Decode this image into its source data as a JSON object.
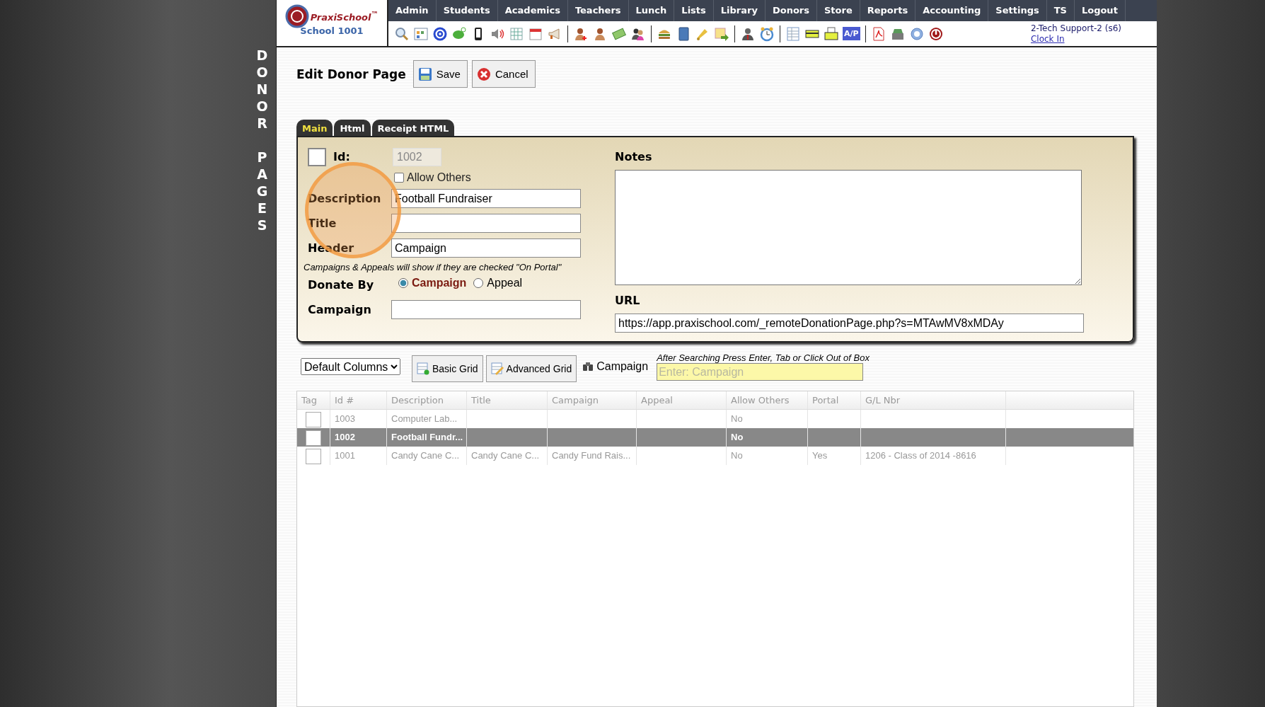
{
  "side_title": "DONOR PAGES",
  "logo": {
    "name": "PraxiSchool$^{™}$",
    "school": "School 1001"
  },
  "menu": [
    "Admin",
    "Students",
    "Academics",
    "Teachers",
    "Lunch",
    "Lists",
    "Library",
    "Donors",
    "Store",
    "Reports",
    "Accounting",
    "Settings",
    "TS",
    "Logout"
  ],
  "toolbar": {
    "ap_label": "A/P"
  },
  "user": {
    "name": "2-Tech Support-2 (s6)",
    "link": "Clock In"
  },
  "page_title": "Edit Donor Page",
  "buttons": [
    {
      "label": "Save",
      "kind": "save"
    },
    {
      "label": "Cancel",
      "kind": "cancel"
    }
  ],
  "tabs": [
    {
      "label": "Main",
      "selected": true
    },
    {
      "label": "Html",
      "selected": false
    },
    {
      "label": "Receipt HTML",
      "selected": false
    }
  ],
  "form": {
    "tagged": false,
    "id_label": "Id:",
    "id_value": "1002",
    "allow_others": {
      "label": "Allow Others",
      "checked": false
    },
    "fields": [
      {
        "label": "Description",
        "value": "Football Fundraiser"
      },
      {
        "label": "Title"
      },
      {
        "label": "Header",
        "value": "Campaign"
      }
    ],
    "hint": "Campaigns & Appeals will show if they are checked \"On Portal\"",
    "donate_by": {
      "label": "Donate By",
      "options": [
        {
          "label": "Campaign",
          "selected": true
        },
        {
          "label": "Appeal",
          "selected": false
        }
      ]
    },
    "campaign": {
      "label": "Campaign"
    },
    "notes_label": "Notes",
    "url_label": "URL",
    "url_value": "https://app.praxischool.com/_remoteDonationPage.php?s=MTAwMV8xMDAy"
  },
  "grid_bar": {
    "columns_select": "Default Columns",
    "basic": "Basic Grid",
    "advanced": "Advanced Grid",
    "search_label": "Campaign",
    "search_hint": "After Searching Press Enter, Tab or Click Out of Box",
    "search_placeholder": "Enter: Campaign"
  },
  "table": {
    "columns": [
      "Tag",
      "Id #",
      "Description",
      "Title",
      "Campaign",
      "Appeal",
      "Allow Others",
      "Portal",
      "G/L Nbr"
    ],
    "rows": [
      {
        "selected": false,
        "tagged": false,
        "cells": [
          "",
          "1003",
          "Computer Lab...",
          "",
          "",
          "",
          "No",
          "",
          ""
        ]
      },
      {
        "selected": true,
        "tagged": false,
        "cells": [
          "",
          "1002",
          "Football Fundr...",
          "",
          "",
          "",
          "No",
          "",
          ""
        ]
      },
      {
        "selected": false,
        "tagged": false,
        "cells": [
          "",
          "1001",
          "Candy Cane C...",
          "Candy Cane C...",
          "Candy Fund Rais...",
          "",
          "No",
          "Yes",
          "1206 - Class of 2014 -8616"
        ]
      }
    ]
  }
}
